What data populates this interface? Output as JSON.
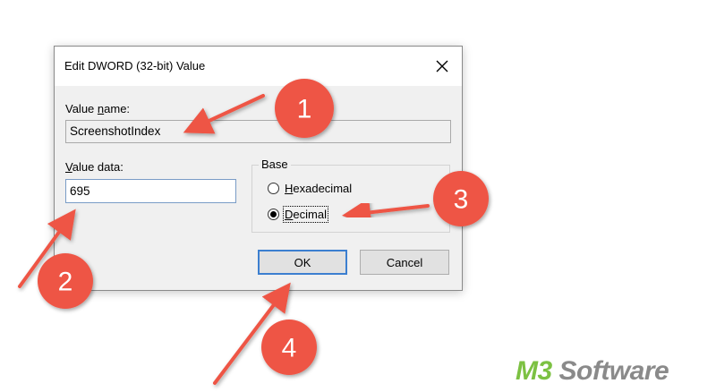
{
  "dialog": {
    "title": "Edit DWORD (32-bit) Value",
    "value_name_label_prefix": "Value ",
    "value_name_label_key": "n",
    "value_name_label_rest": "ame:",
    "value_name": "ScreenshotIndex",
    "value_data_label_key": "V",
    "value_data_label_rest": "alue data:",
    "value_data": "695",
    "base_group_title": "Base",
    "radio_hex_key": "H",
    "radio_hex_rest": "exadecimal",
    "radio_hex_checked": false,
    "radio_dec_key": "D",
    "radio_dec_rest": "ecimal",
    "radio_dec_checked": true,
    "ok_label": "OK",
    "cancel_label": "Cancel"
  },
  "annotations": {
    "color": "#ee5545",
    "steps": [
      "1",
      "2",
      "3",
      "4"
    ]
  },
  "watermark": {
    "brand_a": "M3",
    "brand_b": " Software",
    "brand_a_color": "#7cc142",
    "brand_b_color": "#8a8a8a"
  }
}
